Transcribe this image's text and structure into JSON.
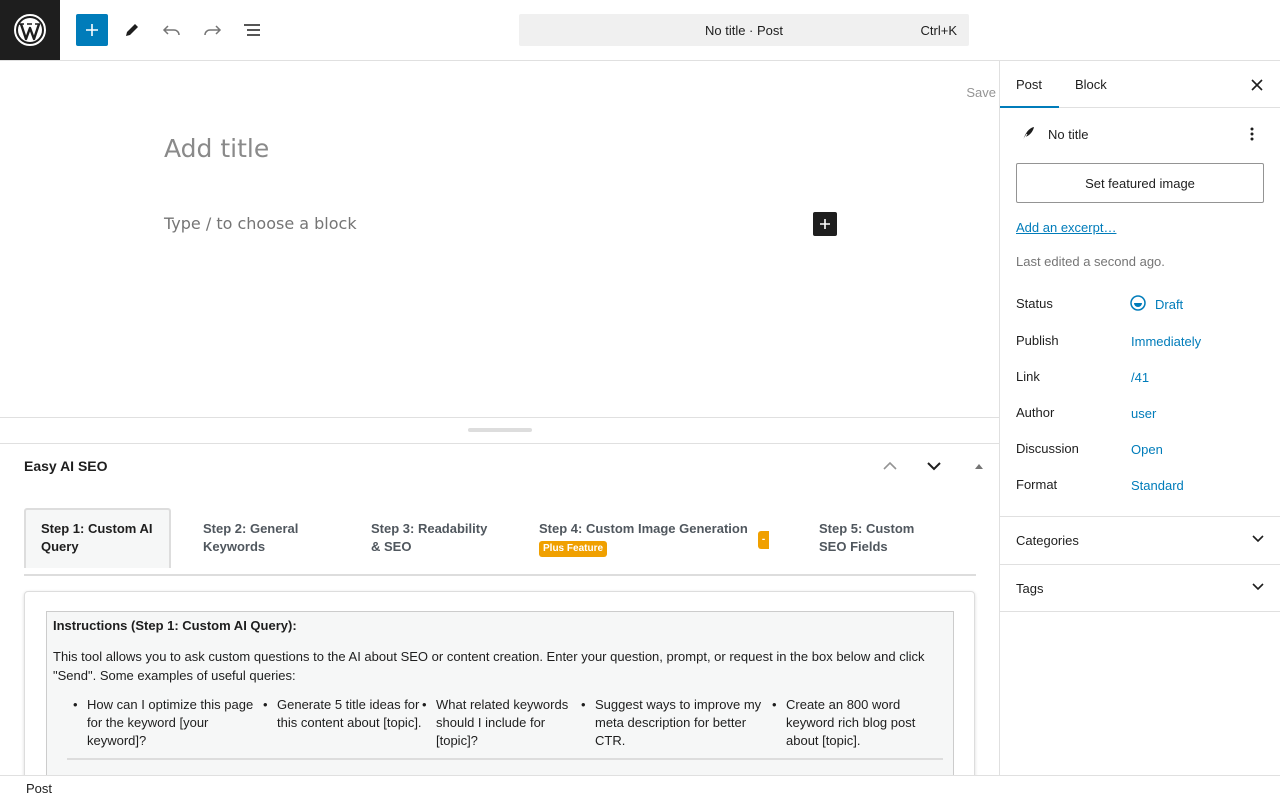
{
  "header": {
    "command_title": "No title · Post",
    "command_shortcut": "Ctrl+K"
  },
  "editor": {
    "save_label": "Save",
    "title_placeholder": "Add title",
    "block_placeholder": "Type / to choose a block"
  },
  "metabox": {
    "title": "Easy AI SEO",
    "tabs": [
      {
        "label_line1": "Step 1: Custom AI",
        "label_line2": "Query"
      },
      {
        "label_line1": "Step 2: General",
        "label_line2": "Keywords"
      },
      {
        "label_line1": "Step 3: Readability",
        "label_line2": "& SEO"
      },
      {
        "label_line1": "Step 4: Custom Image Generation",
        "badge": "Plus Feature"
      },
      {
        "label_line1": "Step 5: Custom",
        "label_line2": "SEO Fields"
      }
    ],
    "instructions_heading": "Instructions (Step 1: Custom AI Query):",
    "instructions_text": "This tool allows you to ask custom questions to the AI about SEO or content creation. Enter your question, prompt, or request in the box below and click \"Send\". Some examples of useful queries:",
    "examples": [
      "How can I optimize this page for the keyword [your keyword]?",
      "Generate 5 title ideas for this content about [topic].",
      "What related keywords should I include for [topic]?",
      "Suggest ways to improve my meta description for better CTR.",
      "Create an 800 word keyword rich blog post about [topic]."
    ]
  },
  "statusbar": {
    "label": "Post"
  },
  "sidebar": {
    "tab_post": "Post",
    "tab_block": "Block",
    "post_title": "No title",
    "featured_button": "Set featured image",
    "excerpt_link": "Add an excerpt…",
    "last_edited": "Last edited a second ago.",
    "rows": [
      {
        "label": "Status",
        "value": "Draft"
      },
      {
        "label": "Publish",
        "value": "Immediately"
      },
      {
        "label": "Link",
        "value": "/41"
      },
      {
        "label": "Author",
        "value": "user"
      },
      {
        "label": "Discussion",
        "value": "Open"
      },
      {
        "label": "Format",
        "value": "Standard"
      }
    ],
    "sections": [
      {
        "label": "Categories"
      },
      {
        "label": "Tags"
      }
    ]
  },
  "colors": {
    "accent": "#007cba",
    "plus_badge": "#f0a000"
  }
}
